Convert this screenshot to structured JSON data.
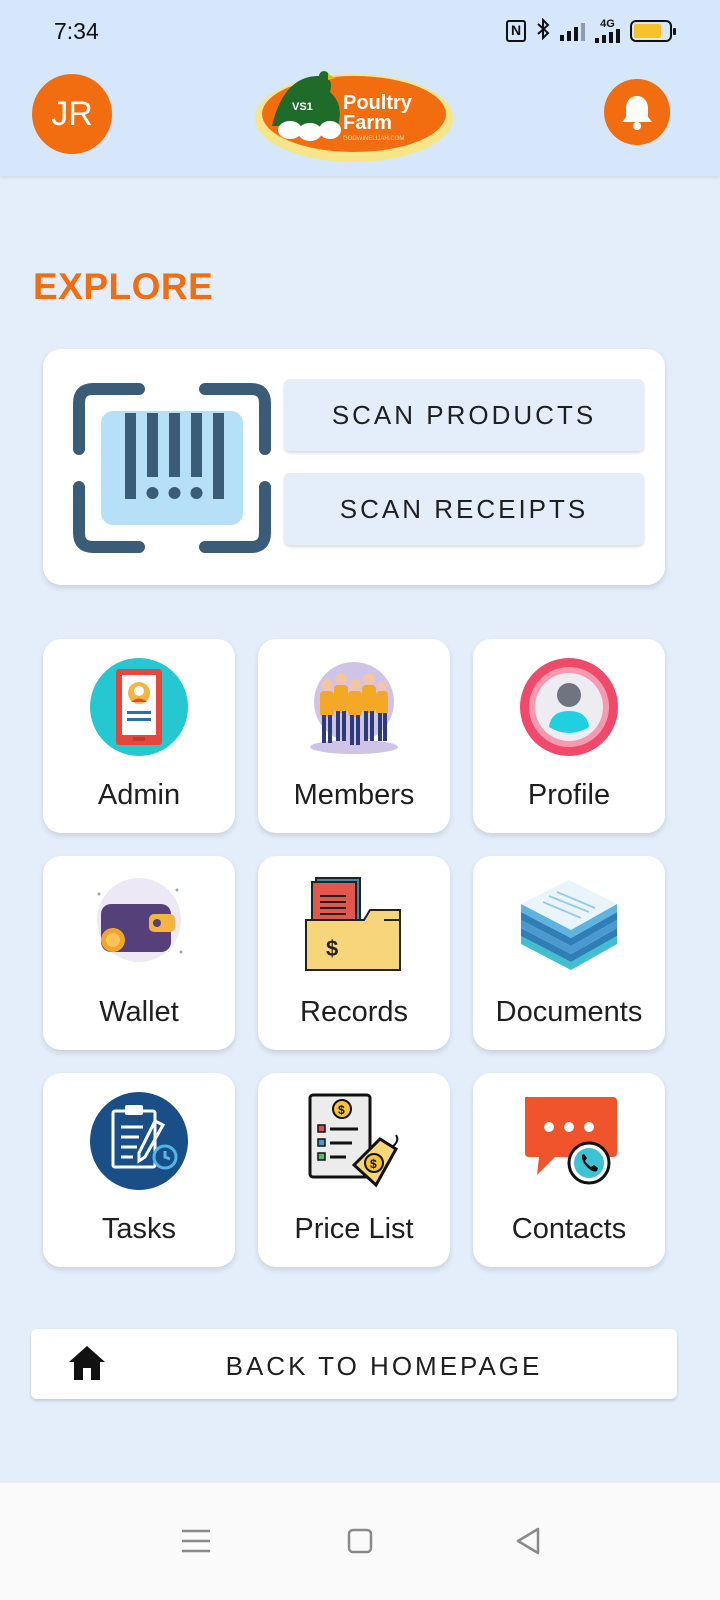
{
  "status_bar": {
    "time": "7:34",
    "network": "4G",
    "battery_level": 0.8,
    "icons": [
      "nfc-icon",
      "bluetooth-icon",
      "signal-icon",
      "4g-signal-icon",
      "battery-icon"
    ]
  },
  "header": {
    "avatar_initials": "JR",
    "logo": {
      "badge": "VS1",
      "line1": "Poultry",
      "line2": "Farm",
      "domain": "GODWINELIJAH.COM"
    },
    "notification_icon": "bell-icon"
  },
  "explore": {
    "title": "EXPLORE",
    "scan_products_label": "SCAN PRODUCTS",
    "scan_receipts_label": "SCAN RECEIPTS"
  },
  "tiles": [
    {
      "label": "Admin",
      "icon": "admin-id-icon"
    },
    {
      "label": "Members",
      "icon": "members-group-icon"
    },
    {
      "label": "Profile",
      "icon": "profile-user-icon"
    },
    {
      "label": "Wallet",
      "icon": "wallet-icon"
    },
    {
      "label": "Records",
      "icon": "records-folder-icon"
    },
    {
      "label": "Documents",
      "icon": "documents-stack-icon"
    },
    {
      "label": "Tasks",
      "icon": "tasks-clipboard-icon"
    },
    {
      "label": "Price List",
      "icon": "price-list-icon"
    },
    {
      "label": "Contacts",
      "icon": "contacts-chat-icon"
    }
  ],
  "back_to_homepage_label": "BACK TO HOMEPAGE",
  "colors": {
    "accent": "#f26d0f",
    "background": "#e4eefb",
    "header": "#d6e6fb"
  }
}
